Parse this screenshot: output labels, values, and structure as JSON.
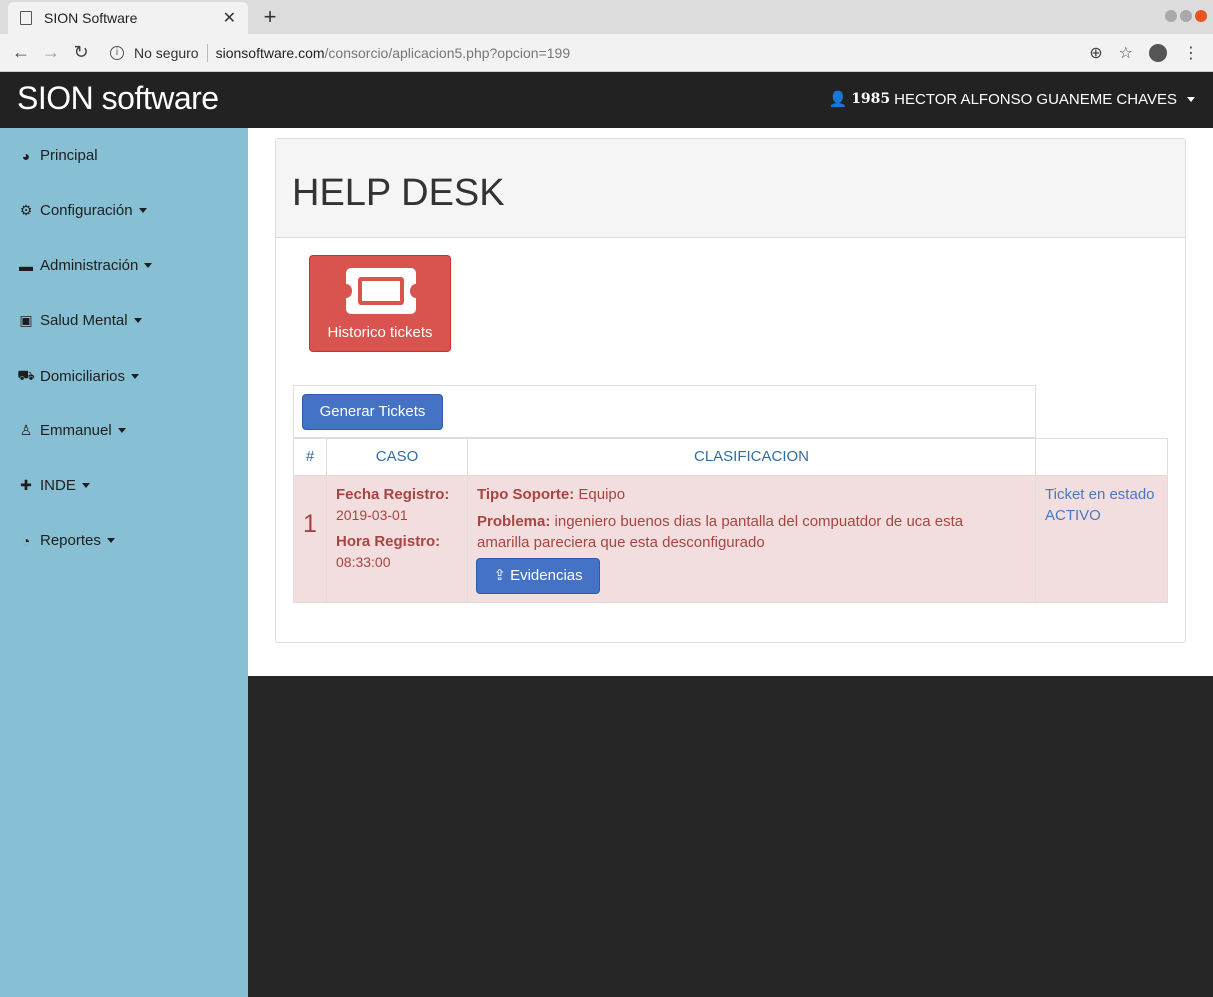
{
  "browser": {
    "tab_title": "SION Software",
    "new_tab": "+",
    "security_label": "No seguro",
    "url_domain": "sionsoftware.com",
    "url_path": "/consorcio/aplicacion5.php?opcion=199"
  },
  "header": {
    "brand": "SION software",
    "user_id": "1985",
    "user_name": "HECTOR ALFONSO GUANEME CHAVES"
  },
  "sidebar": {
    "items": [
      {
        "label": "Principal",
        "icon": "dashboard-icon",
        "has_caret": false
      },
      {
        "label": "Configuración",
        "icon": "cogs-icon",
        "has_caret": true
      },
      {
        "label": "Administración",
        "icon": "briefcase-icon",
        "has_caret": true
      },
      {
        "label": "Salud Mental",
        "icon": "hospital-icon",
        "has_caret": true
      },
      {
        "label": "Domiciliarios",
        "icon": "ambulance-icon",
        "has_caret": true
      },
      {
        "label": "Emmanuel",
        "icon": "child-icon",
        "has_caret": true
      },
      {
        "label": "INDE",
        "icon": "puzzle-icon",
        "has_caret": true
      },
      {
        "label": "Reportes",
        "icon": "pie-chart-icon",
        "has_caret": true
      }
    ]
  },
  "main": {
    "title": "HELP DESK",
    "historic_button": "Historico tickets",
    "generate_button": "Generar Tickets",
    "table": {
      "headers": [
        "#",
        "CASO",
        "CLASIFICACION",
        ""
      ],
      "rows": [
        {
          "num": "1",
          "fecha_label": "Fecha Registro:",
          "fecha": "2019-03-01",
          "hora_label": "Hora Registro:",
          "hora": "08:33:00",
          "tipo_label": "Tipo Soporte:",
          "tipo": "Equipo",
          "problema_label": "Problema:",
          "problema": "ingeniero buenos dias la pantalla del compuatdor de uca esta amarilla pareciera que esta desconfigurado",
          "evidencias": "Evidencias",
          "status": "Ticket en estado ACTIVO"
        }
      ]
    }
  },
  "colors": {
    "header_bg": "#222222",
    "sidebar_bg": "#87c0d4",
    "danger": "#d9534f",
    "primary": "#4472c4",
    "row_danger_bg": "#f2dede",
    "row_danger_text": "#a94442"
  }
}
